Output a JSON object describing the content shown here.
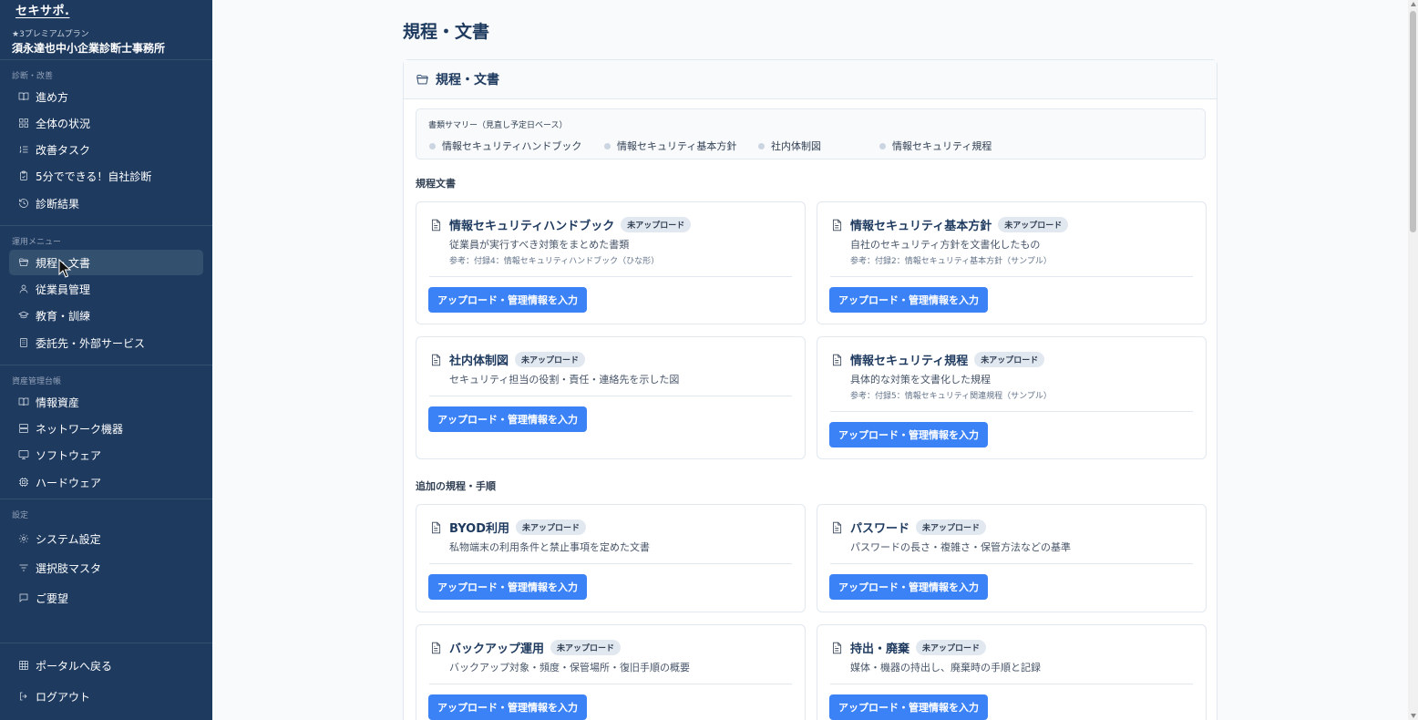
{
  "sidebar": {
    "brand_logo": "セキサポ.",
    "plan": "★3プレミアムプラン",
    "company": "須永達也中小企業診断士事務所",
    "sections": [
      {
        "label": "診断・改善"
      },
      {
        "label": "運用メニュー"
      },
      {
        "label": "資産管理台帳"
      },
      {
        "label": "設定"
      }
    ],
    "items": [
      {
        "label": "進め方",
        "icon": "book-open-icon"
      },
      {
        "label": "全体の状況",
        "icon": "grid-icon"
      },
      {
        "label": "改善タスク",
        "icon": "list-ordered-icon"
      },
      {
        "label": "5分でできる！自社診断",
        "icon": "clipboard-check-icon"
      },
      {
        "label": "診断結果",
        "icon": "history-icon"
      },
      {
        "label": "規程・文書",
        "icon": "folder-icon"
      },
      {
        "label": "従業員管理",
        "icon": "user-icon"
      },
      {
        "label": "教育・訓練",
        "icon": "graduation-cap-icon"
      },
      {
        "label": "委託先・外部サービス",
        "icon": "building-icon"
      },
      {
        "label": "情報資産",
        "icon": "book-open-icon"
      },
      {
        "label": "ネットワーク機器",
        "icon": "server-icon"
      },
      {
        "label": "ソフトウェア",
        "icon": "monitor-icon"
      },
      {
        "label": "ハードウェア",
        "icon": "cpu-icon"
      },
      {
        "label": "システム設定",
        "icon": "gear-icon"
      },
      {
        "label": "選択肢マスタ",
        "icon": "filter-icon"
      },
      {
        "label": "ご要望",
        "icon": "message-square-icon"
      }
    ],
    "footer": [
      {
        "label": "ポータルへ戻る",
        "icon": "grid-icon"
      },
      {
        "label": "ログアウト",
        "icon": "logout-icon"
      }
    ]
  },
  "main": {
    "title": "規程・文書",
    "panel_title": "規程・文書",
    "summary": {
      "title": "書類サマリー（見直し予定日ベース）",
      "items": [
        "情報セキュリティハンドブック",
        "情報セキュリティ基本方針",
        "社内体制図",
        "情報セキュリティ規程"
      ]
    },
    "groups": [
      {
        "label": "規程文書"
      },
      {
        "label": "追加の規程・手順"
      }
    ],
    "cards": [
      {
        "title": "情報セキュリティハンドブック",
        "badge": "未アップロード",
        "desc": "従業員が実行すべき対策をまとめた書類",
        "ref": "参考：付録4：情報セキュリティハンドブック（ひな形）",
        "button": "アップロード・管理情報を入力"
      },
      {
        "title": "情報セキュリティ基本方針",
        "badge": "未アップロード",
        "desc": "自社のセキュリティ方針を文書化したもの",
        "ref": "参考：付録2：情報セキュリティ基本方針（サンプル）",
        "button": "アップロード・管理情報を入力"
      },
      {
        "title": "社内体制図",
        "badge": "未アップロード",
        "desc": "セキュリティ担当の役割・責任・連絡先を示した図",
        "ref": "",
        "button": "アップロード・管理情報を入力"
      },
      {
        "title": "情報セキュリティ規程",
        "badge": "未アップロード",
        "desc": "具体的な対策を文書化した規程",
        "ref": "参考：付録5：情報セキュリティ関連規程（サンプル）",
        "button": "アップロード・管理情報を入力"
      },
      {
        "title": "BYOD利用",
        "badge": "未アップロード",
        "desc": "私物端末の利用条件と禁止事項を定めた文書",
        "ref": "",
        "button": "アップロード・管理情報を入力"
      },
      {
        "title": "パスワード",
        "badge": "未アップロード",
        "desc": "パスワードの長さ・複雑さ・保管方法などの基準",
        "ref": "",
        "button": "アップロード・管理情報を入力"
      },
      {
        "title": "バックアップ運用",
        "badge": "未アップロード",
        "desc": "バックアップ対象・頻度・保管場所・復旧手順の概要",
        "ref": "",
        "button": "アップロード・管理情報を入力"
      },
      {
        "title": "持出・廃棄",
        "badge": "未アップロード",
        "desc": "媒体・機器の持出し、廃棄時の手順と記録",
        "ref": "",
        "button": "アップロード・管理情報を入力"
      }
    ]
  },
  "colors": {
    "sidebar_bg": "#1e3a5f",
    "active_item": "#34506f",
    "primary": "#3b82f6",
    "title": "#1e3a5f"
  }
}
